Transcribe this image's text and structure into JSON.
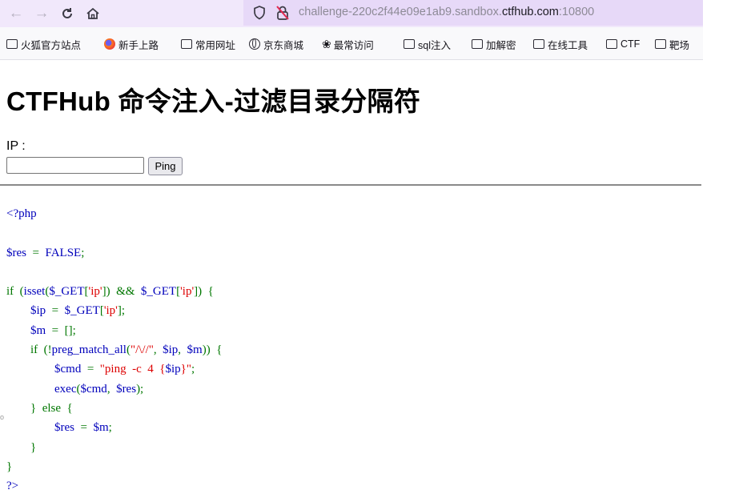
{
  "browser": {
    "url_prefix": "challenge-220c2f44e09e1ab9.sandbox.",
    "url_domain": "ctfhub.com",
    "url_suffix": ":10800",
    "icons": [
      "back-arrow",
      "forward-arrow",
      "reload",
      "home",
      "shield",
      "lock-slash"
    ]
  },
  "bookmarks": [
    {
      "label": "火狐官方站点",
      "icon": "folder"
    },
    {
      "label": "新手上路",
      "icon": "firefox"
    },
    {
      "label": "常用网址",
      "icon": "folder"
    },
    {
      "label": "京东商城",
      "icon": "globe"
    },
    {
      "label": "最常访问",
      "icon": "gear"
    },
    {
      "label": "sql注入",
      "icon": "folder"
    },
    {
      "label": "加解密",
      "icon": "folder"
    },
    {
      "label": "在线工具",
      "icon": "folder"
    },
    {
      "label": "CTF",
      "icon": "folder"
    },
    {
      "label": "靶场",
      "icon": "folder"
    }
  ],
  "page": {
    "title": "CTFHub 命令注入-过滤目录分隔符",
    "ip_label": "IP :",
    "ip_value": "",
    "ping_label": "Ping"
  },
  "code_lines": [
    [
      {
        "t": "<?php",
        "c": "def"
      }
    ],
    [],
    [
      {
        "t": "$res",
        "c": "def"
      },
      {
        "t": "  =  ",
        "c": "kw"
      },
      {
        "t": "FALSE",
        "c": "def"
      },
      {
        "t": ";",
        "c": "kw"
      }
    ],
    [],
    [
      {
        "t": "if  (",
        "c": "kw"
      },
      {
        "t": "isset",
        "c": "def"
      },
      {
        "t": "(",
        "c": "kw"
      },
      {
        "t": "$_GET",
        "c": "def"
      },
      {
        "t": "[",
        "c": "kw"
      },
      {
        "t": "'ip'",
        "c": "str"
      },
      {
        "t": "])  &&  ",
        "c": "kw"
      },
      {
        "t": "$_GET",
        "c": "def"
      },
      {
        "t": "[",
        "c": "kw"
      },
      {
        "t": "'ip'",
        "c": "str"
      },
      {
        "t": "])  {",
        "c": "kw"
      }
    ],
    [
      {
        "t": "        ",
        "c": "kw"
      },
      {
        "t": "$ip",
        "c": "def"
      },
      {
        "t": "  =  ",
        "c": "kw"
      },
      {
        "t": "$_GET",
        "c": "def"
      },
      {
        "t": "[",
        "c": "kw"
      },
      {
        "t": "'ip'",
        "c": "str"
      },
      {
        "t": "];",
        "c": "kw"
      }
    ],
    [
      {
        "t": "        ",
        "c": "kw"
      },
      {
        "t": "$m",
        "c": "def"
      },
      {
        "t": "  =  [];",
        "c": "kw"
      }
    ],
    [
      {
        "t": "        if  (!",
        "c": "kw"
      },
      {
        "t": "preg_match_all",
        "c": "def"
      },
      {
        "t": "(",
        "c": "kw"
      },
      {
        "t": "\"/\\//\"",
        "c": "str"
      },
      {
        "t": ",  ",
        "c": "kw"
      },
      {
        "t": "$ip",
        "c": "def"
      },
      {
        "t": ",  ",
        "c": "kw"
      },
      {
        "t": "$m",
        "c": "def"
      },
      {
        "t": "))  {",
        "c": "kw"
      }
    ],
    [
      {
        "t": "                ",
        "c": "kw"
      },
      {
        "t": "$cmd",
        "c": "def"
      },
      {
        "t": "  =  ",
        "c": "kw"
      },
      {
        "t": "\"ping  -c  4  {",
        "c": "str"
      },
      {
        "t": "$ip",
        "c": "def"
      },
      {
        "t": "}\"",
        "c": "str"
      },
      {
        "t": ";",
        "c": "kw"
      }
    ],
    [
      {
        "t": "                ",
        "c": "kw"
      },
      {
        "t": "exec",
        "c": "def"
      },
      {
        "t": "(",
        "c": "kw"
      },
      {
        "t": "$cmd",
        "c": "def"
      },
      {
        "t": ",  ",
        "c": "kw"
      },
      {
        "t": "$res",
        "c": "def"
      },
      {
        "t": ");",
        "c": "kw"
      }
    ],
    [
      {
        "t": "        }  else  {",
        "c": "kw"
      }
    ],
    [
      {
        "t": "                ",
        "c": "kw"
      },
      {
        "t": "$res",
        "c": "def"
      },
      {
        "t": "  =  ",
        "c": "kw"
      },
      {
        "t": "$m",
        "c": "def"
      },
      {
        "t": ";",
        "c": "kw"
      }
    ],
    [
      {
        "t": "        }",
        "c": "kw"
      }
    ],
    [
      {
        "t": "}",
        "c": "kw"
      }
    ],
    [
      {
        "t": "?>",
        "c": "def"
      }
    ]
  ]
}
